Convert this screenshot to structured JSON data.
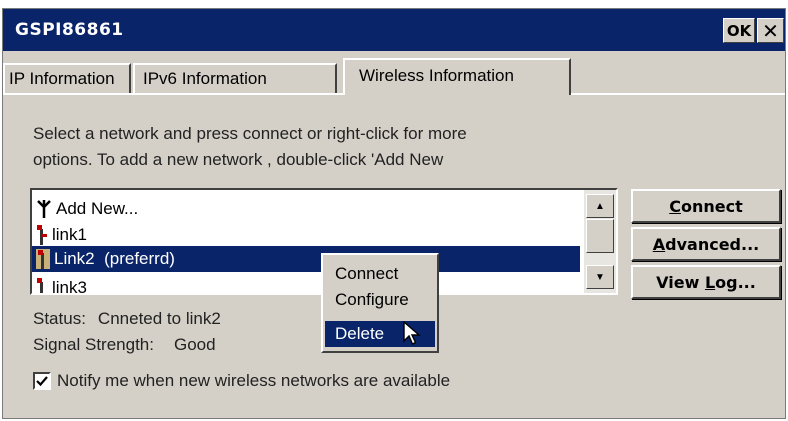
{
  "window": {
    "title": "GSPI86861",
    "ok_label": "OK",
    "close_label": "✕"
  },
  "tabs": [
    {
      "label": "IP Information"
    },
    {
      "label": "IPv6 Information"
    },
    {
      "label": "Wireless Information",
      "active": true
    }
  ],
  "description": {
    "line1": "Select a network and press connect or right-click for more",
    "line2": "options. To add a new network , double-click 'Add New"
  },
  "networks": [
    {
      "label": "Add New...",
      "icon": "antenna-icon"
    },
    {
      "label": "link1",
      "icon": "network-icon"
    },
    {
      "label": "Link2  (preferrd)",
      "icon": "network-icon",
      "selected": true
    },
    {
      "label": "link3",
      "icon": "network-icon"
    }
  ],
  "buttons": {
    "connect": {
      "mnemonic": "C",
      "rest": "onnect"
    },
    "advanced": {
      "mnemonic": "A",
      "rest": "dvanced..."
    },
    "view_log": {
      "prefix": "View ",
      "mnemonic": "L",
      "rest": "og..."
    }
  },
  "status": {
    "label": "Status:",
    "value": "Cnneted to link2"
  },
  "signal": {
    "label": "Signal Strength:",
    "value": "Good"
  },
  "notify": {
    "label": "Notify me when new wireless networks are available",
    "checked": true
  },
  "context_menu": {
    "items": [
      {
        "label": "Connect"
      },
      {
        "label": "Configure"
      },
      {
        "label": "Delete",
        "highlighted": true
      }
    ]
  },
  "colors": {
    "titlebar": "#0a246a",
    "face": "#d4d0c8",
    "selection": "#0a246a"
  }
}
